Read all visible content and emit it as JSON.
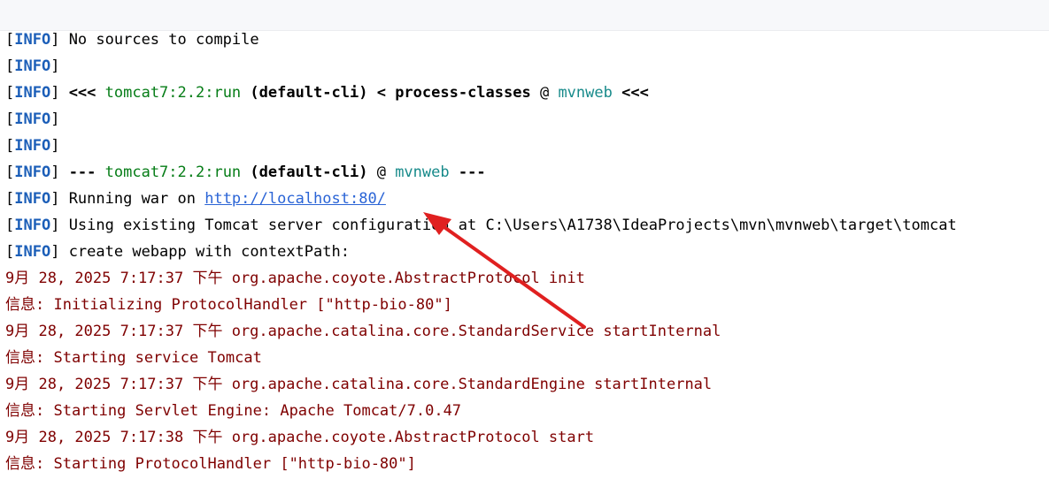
{
  "console": {
    "lines": [
      {
        "kind": "info",
        "text": "No sources to compile"
      },
      {
        "kind": "info",
        "text": ""
      },
      {
        "kind": "info_goal",
        "prefix": "<<< ",
        "goal": "tomcat7:2.2:run",
        "exec": " (default-cli)",
        "mid": " < ",
        "phase": "process-classes",
        "at": " @ ",
        "project": "mvnweb",
        "suffix": " <<<"
      },
      {
        "kind": "info",
        "text": ""
      },
      {
        "kind": "info",
        "text": ""
      },
      {
        "kind": "info_goal2",
        "prefix": "--- ",
        "goal": "tomcat7:2.2:run",
        "exec": " (default-cli)",
        "at": " @ ",
        "project": "mvnweb",
        "suffix": " ---"
      },
      {
        "kind": "info_link",
        "text": "Running war on ",
        "link": "http://localhost:80/"
      },
      {
        "kind": "info",
        "text": "Using existing Tomcat server configuration at C:\\Users\\A1738\\IdeaProjects\\mvn\\mvnweb\\target\\tomcat"
      },
      {
        "kind": "info",
        "text": "create webapp with contextPath:"
      },
      {
        "kind": "log",
        "text": "9月 28, 2025 7:17:37 下午 org.apache.coyote.AbstractProtocol init"
      },
      {
        "kind": "log",
        "text": "信息: Initializing ProtocolHandler [\"http-bio-80\"]"
      },
      {
        "kind": "log",
        "text": "9月 28, 2025 7:17:37 下午 org.apache.catalina.core.StandardService startInternal"
      },
      {
        "kind": "log",
        "text": "信息: Starting service Tomcat"
      },
      {
        "kind": "log",
        "text": "9月 28, 2025 7:17:37 下午 org.apache.catalina.core.StandardEngine startInternal"
      },
      {
        "kind": "log",
        "text": "信息: Starting Servlet Engine: Apache Tomcat/7.0.47"
      },
      {
        "kind": "log",
        "text": "9月 28, 2025 7:17:38 下午 org.apache.coyote.AbstractProtocol start"
      },
      {
        "kind": "log",
        "text": "信息: Starting ProtocolHandler [\"http-bio-80\"]"
      }
    ],
    "tag": {
      "open": "[",
      "label": "INFO",
      "close": "]"
    }
  },
  "colors": {
    "info": "#1b5eb8",
    "goal": "#067d17",
    "project": "#178a8a",
    "link": "#2a64d6",
    "log": "#7f0000",
    "arrow": "#e02020"
  },
  "annotation": {
    "icon": "red-arrow-icon"
  }
}
